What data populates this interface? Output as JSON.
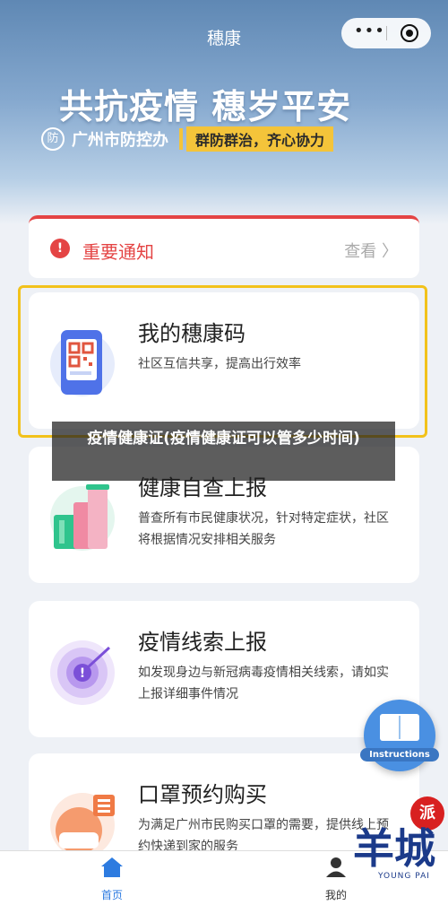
{
  "navbar": {
    "title": "穗康",
    "more_icon": "more-dots-icon",
    "close_icon": "target-close-icon"
  },
  "hero": {
    "slogan": "共抗疫情 穗岁平安",
    "brand_logo_text": "防",
    "brand_name": "广州市防控办",
    "tagline": "群防群治，齐心协力"
  },
  "notice": {
    "title": "重要通知",
    "more": "查看 〉",
    "icon": "alert-icon"
  },
  "cards": [
    {
      "title": "我的穗康码",
      "desc": "社区互信共享，提高出行效率",
      "icon": "qr-phone-icon"
    },
    {
      "title": "健康自查上报",
      "desc": "普查所有市民健康状况，针对特定症状，社区将根据情况安排相关服务",
      "icon": "test-tube-icon"
    },
    {
      "title": "疫情线索上报",
      "desc": "如发现身边与新冠病毒疫情相关线索，请如实上报详细事件情况",
      "icon": "radar-alert-icon"
    },
    {
      "title": "口罩预约购买",
      "desc": "为满足广州市民购买口罩的需要，提供线上预约快递到家的服务",
      "icon": "mask-person-icon"
    }
  ],
  "overlay": {
    "text": "疫情健康证(疫情健康证可以管多少时间)"
  },
  "fab": {
    "label": "Instructions",
    "icon": "book-icon"
  },
  "tabbar": {
    "home": "首页",
    "mine": "我的"
  },
  "watermark": {
    "seal": "派",
    "text": "羊城",
    "sub": "YOUNG PAI"
  },
  "colors": {
    "accent": "#2d7be0",
    "alert": "#e44444",
    "highlight": "#f2c21b"
  }
}
